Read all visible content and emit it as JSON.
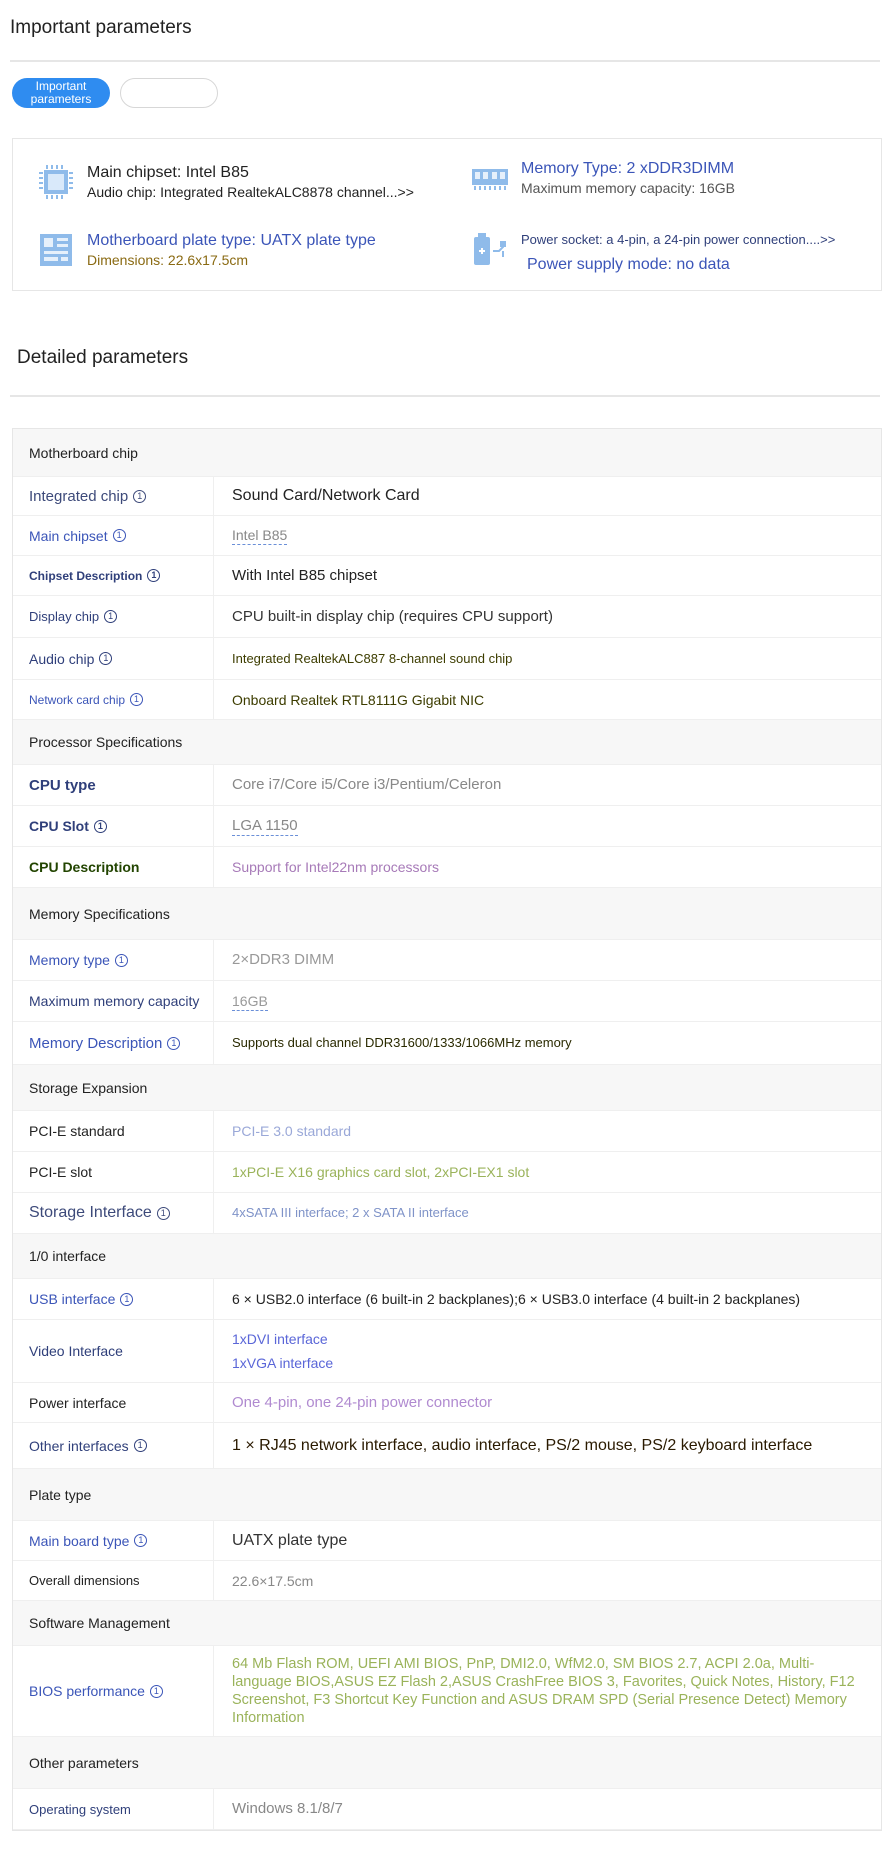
{
  "header": {
    "title": "Important parameters"
  },
  "tabs": [
    {
      "label": "Important\nparameters",
      "active": true
    },
    {
      "label": "",
      "active": false
    }
  ],
  "summary": {
    "chipset": {
      "line1": "Main chipset: Intel B85",
      "line2": "Audio chip: Integrated RealtekALC8878 channel...>>"
    },
    "memory": {
      "line1": "Memory Type: 2 xDDR3DIMM",
      "line2": "Maximum memory capacity: 16GB"
    },
    "plate": {
      "line1": "Motherboard plate type: UATX plate type",
      "line2": "Dimensions: 22.6x17.5cm"
    },
    "power": {
      "line1": "Power socket: a 4-pin, a 24-pin power connection....>>",
      "line2": "Power supply mode: no data"
    }
  },
  "detailed": {
    "title": "Detailed parameters"
  },
  "info_glyph": "①",
  "groups": [
    {
      "name": "Motherboard chip",
      "rows": [
        {
          "key": "Integrated chip",
          "info": true,
          "value": [
            "Sound Card/Network Card"
          ]
        },
        {
          "key": "Main chipset",
          "info": true,
          "value": [
            "Intel B85"
          ]
        },
        {
          "key": "Chipset Description",
          "info": true,
          "value": [
            "With Intel B85 chipset"
          ]
        },
        {
          "key": "Display chip",
          "info": true,
          "value": [
            "CPU built-in display chip (requires CPU support)"
          ]
        },
        {
          "key": "Audio chip",
          "info": true,
          "value": [
            "Integrated RealtekALC887 8-channel sound chip"
          ]
        },
        {
          "key": "Network card chip",
          "info": true,
          "value": [
            "Onboard Realtek RTL8111G Gigabit NIC"
          ]
        }
      ]
    },
    {
      "name": "Processor Specifications",
      "rows": [
        {
          "key": "CPU type",
          "info": false,
          "value": [
            "Core i7/Core i5/Core i3/Pentium/Celeron"
          ]
        },
        {
          "key": "CPU Slot",
          "info": true,
          "value": [
            "LGA 1150"
          ]
        },
        {
          "key": "CPU Description",
          "info": false,
          "value": [
            "Support for Intel22nm processors"
          ]
        }
      ]
    },
    {
      "name": "Memory Specifications",
      "rows": [
        {
          "key": "Memory type",
          "info": true,
          "value": [
            "2×DDR3 DIMM"
          ]
        },
        {
          "key": "Maximum memory capacity",
          "info": false,
          "value": [
            "16GB"
          ]
        },
        {
          "key": "Memory Description",
          "info": true,
          "value": [
            "Supports dual channel DDR31600/1333/1066MHz memory"
          ]
        }
      ]
    },
    {
      "name": "Storage Expansion",
      "rows": [
        {
          "key": "PCI-E standard",
          "info": false,
          "value": [
            "PCI-E 3.0 standard"
          ]
        },
        {
          "key": "PCI-E slot",
          "info": false,
          "value": [
            "1xPCI-E X16 graphics card slot, 2xPCI-EX1 slot"
          ]
        },
        {
          "key": "Storage Interface",
          "info": true,
          "value": [
            "4xSATA III interface; 2 x SATA II interface"
          ]
        }
      ]
    },
    {
      "name": "1/0 interface",
      "rows": [
        {
          "key": "USB interface",
          "info": true,
          "value": [
            "6 × USB2.0 interface (6 built-in 2 backplanes);6 × USB3.0 interface (4 built-in 2 backplanes)"
          ]
        },
        {
          "key": "Video Interface",
          "info": false,
          "value": [
            "1xDVI interface",
            "1xVGA interface"
          ]
        },
        {
          "key": "Power interface",
          "info": false,
          "value": [
            "One 4-pin, one 24-pin power connector"
          ]
        },
        {
          "key": "Other interfaces",
          "info": true,
          "value": [
            "1 × RJ45 network interface, audio interface, PS/2 mouse, PS/2 keyboard interface"
          ]
        }
      ]
    },
    {
      "name": "Plate type",
      "rows": [
        {
          "key": "Main board type",
          "info": true,
          "value": [
            "UATX plate type"
          ]
        },
        {
          "key": "Overall dimensions",
          "info": false,
          "value": [
            "22.6×17.5cm"
          ]
        }
      ]
    },
    {
      "name": "Software Management",
      "rows": [
        {
          "key": "BIOS performance",
          "info": true,
          "value": [
            "64 Mb Flash ROM, UEFI AMI BIOS, PnP, DMI2.0, WfM2.0, SM BIOS 2.7, ACPI 2.0a, Multi-language BIOS,ASUS EZ Flash 2,ASUS CrashFree BIOS 3, Favorites, Quick Notes, History, F12 Screenshot, F3 Shortcut Key Function and ASUS DRAM SPD (Serial Presence Detect) Memory Information"
          ]
        }
      ]
    },
    {
      "name": "Other parameters",
      "rows": [
        {
          "key": "Operating system",
          "info": false,
          "value": [
            "Windows 8.1/8/7"
          ]
        }
      ]
    }
  ],
  "colors": {
    "accent": "#2f8cf0",
    "summary_blue": "#3b55b8",
    "icon_blue": "#7fb0e8"
  }
}
